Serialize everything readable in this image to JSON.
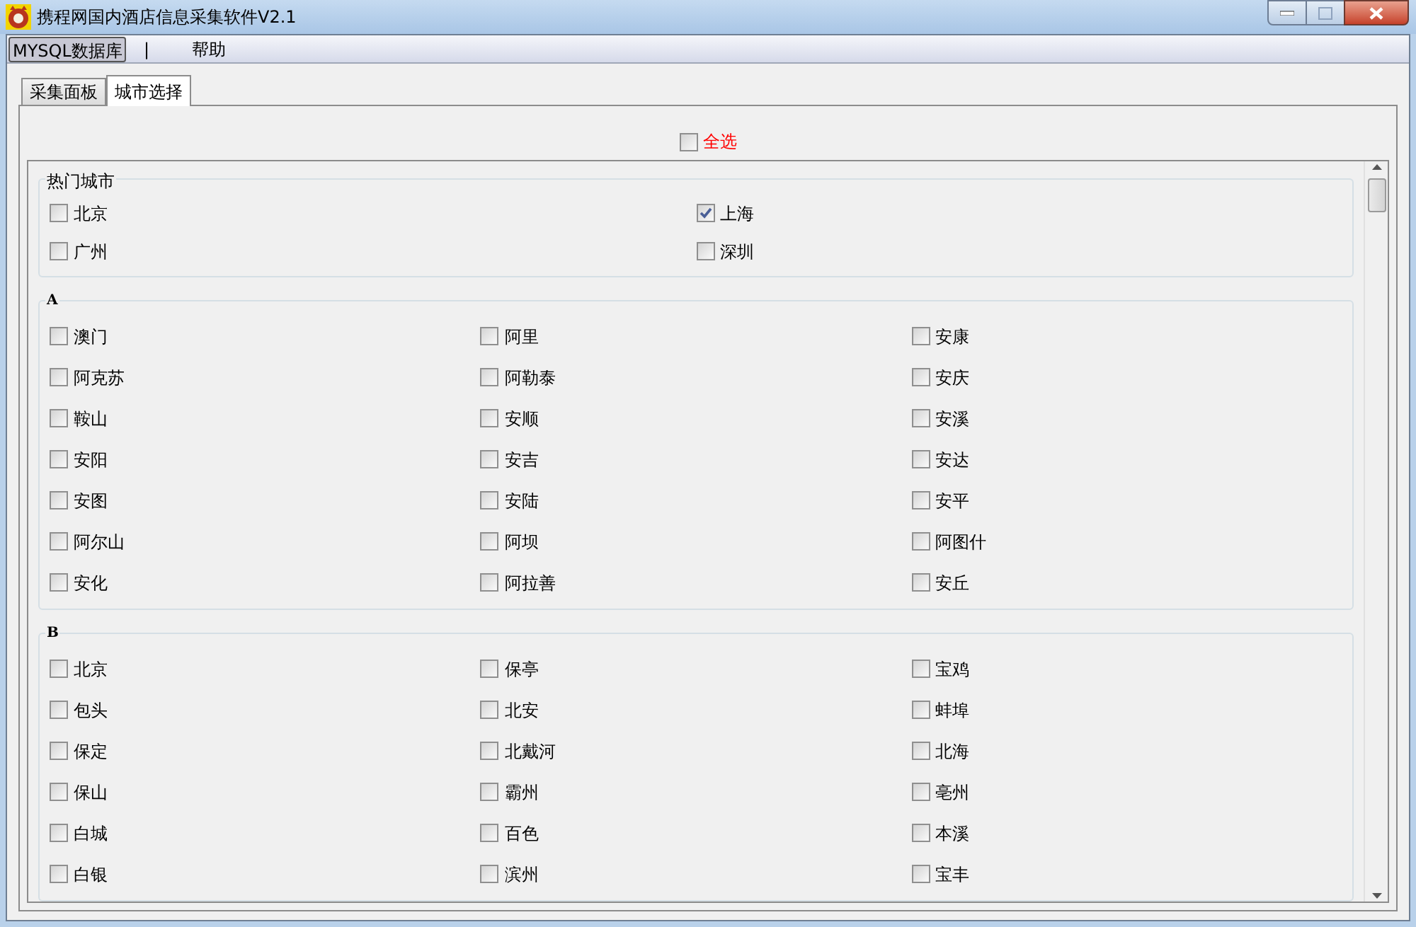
{
  "window": {
    "title": "携程网国内酒店信息采集软件V2.1"
  },
  "menu": [
    {
      "label": "MYSQL数据库",
      "selected": true
    },
    {
      "label": "帮助",
      "selected": false
    }
  ],
  "menu_separator": "|",
  "tabs": [
    {
      "label": "采集面板",
      "selected": false
    },
    {
      "label": "城市选择",
      "selected": true
    }
  ],
  "select_all": {
    "label": "全选",
    "checked": false
  },
  "groups": [
    {
      "title": "热门城市",
      "kind": "hot",
      "cities": [
        {
          "name": "北京",
          "checked": false
        },
        {
          "name": "上海",
          "checked": true
        },
        {
          "name": "广州",
          "checked": false
        },
        {
          "name": "深圳",
          "checked": false
        }
      ]
    },
    {
      "title": "A",
      "kind": "letter",
      "cities": [
        {
          "name": "澳门",
          "checked": false
        },
        {
          "name": "阿里",
          "checked": false
        },
        {
          "name": "安康",
          "checked": false
        },
        {
          "name": "阿克苏",
          "checked": false
        },
        {
          "name": "阿勒泰",
          "checked": false
        },
        {
          "name": "安庆",
          "checked": false
        },
        {
          "name": "鞍山",
          "checked": false
        },
        {
          "name": "安顺",
          "checked": false
        },
        {
          "name": "安溪",
          "checked": false
        },
        {
          "name": "安阳",
          "checked": false
        },
        {
          "name": "安吉",
          "checked": false
        },
        {
          "name": "安达",
          "checked": false
        },
        {
          "name": "安图",
          "checked": false
        },
        {
          "name": "安陆",
          "checked": false
        },
        {
          "name": "安平",
          "checked": false
        },
        {
          "name": "阿尔山",
          "checked": false
        },
        {
          "name": "阿坝",
          "checked": false
        },
        {
          "name": "阿图什",
          "checked": false
        },
        {
          "name": "安化",
          "checked": false
        },
        {
          "name": "阿拉善",
          "checked": false
        },
        {
          "name": "安丘",
          "checked": false
        }
      ]
    },
    {
      "title": "B",
      "kind": "letter",
      "cities": [
        {
          "name": "北京",
          "checked": false
        },
        {
          "name": "保亭",
          "checked": false
        },
        {
          "name": "宝鸡",
          "checked": false
        },
        {
          "name": "包头",
          "checked": false
        },
        {
          "name": "北安",
          "checked": false
        },
        {
          "name": "蚌埠",
          "checked": false
        },
        {
          "name": "保定",
          "checked": false
        },
        {
          "name": "北戴河",
          "checked": false
        },
        {
          "name": "北海",
          "checked": false
        },
        {
          "name": "保山",
          "checked": false
        },
        {
          "name": "霸州",
          "checked": false
        },
        {
          "name": "亳州",
          "checked": false
        },
        {
          "name": "白城",
          "checked": false
        },
        {
          "name": "百色",
          "checked": false
        },
        {
          "name": "本溪",
          "checked": false
        },
        {
          "name": "白银",
          "checked": false
        },
        {
          "name": "滨州",
          "checked": false
        },
        {
          "name": "宝丰",
          "checked": false
        }
      ]
    }
  ]
}
